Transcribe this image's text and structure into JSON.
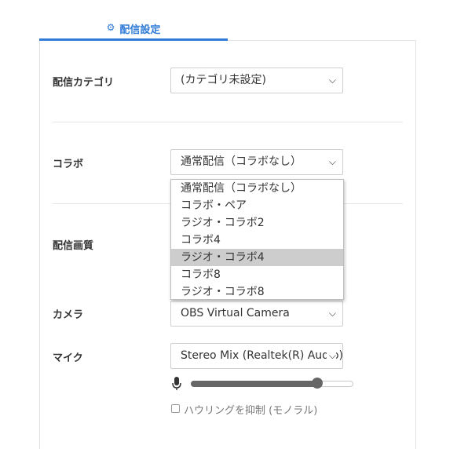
{
  "tab": {
    "icon": "gear-icon",
    "label": "配信設定"
  },
  "category": {
    "label": "配信カテゴリ",
    "value": "(カテゴリ未設定)"
  },
  "collab": {
    "label": "コラボ",
    "value": "通常配信（コラボなし）",
    "options": [
      "通常配信（コラボなし）",
      "コラボ・ペア",
      "ラジオ・コラボ2",
      "コラボ4",
      "ラジオ・コラボ4",
      "コラボ8",
      "ラジオ・コラボ8"
    ],
    "highlighted_option": "ラジオ・コラボ4"
  },
  "quality": {
    "label": "配信画質"
  },
  "camera": {
    "label": "カメラ",
    "value": "OBS Virtual Camera"
  },
  "mic": {
    "label": "マイク",
    "value": "Stereo Mix (Realtek(R) Audio)",
    "volume_icon": "microphone-icon",
    "volume_level": 0.78
  },
  "howling": {
    "label": "ハウリングを抑制 (モノラル)",
    "checked": false
  },
  "colors": {
    "accent": "#2f7bd7",
    "highlight": "#cdcdcd",
    "slider": "#666666"
  }
}
